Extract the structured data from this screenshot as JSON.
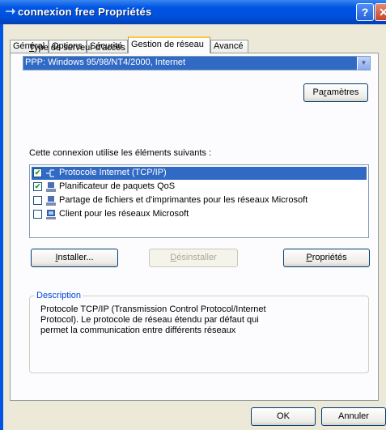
{
  "window": {
    "title": "connexion free Propriétés",
    "help_icon": "help-icon",
    "close_icon": "close-icon",
    "title_icon": "network-connection-icon"
  },
  "tabs": [
    {
      "label": "Général",
      "active": false
    },
    {
      "label": "Options",
      "active": false
    },
    {
      "label": "Sécurité",
      "active": false
    },
    {
      "label": "Gestion de réseau",
      "active": true
    },
    {
      "label": "Avancé",
      "active": false
    }
  ],
  "server_type": {
    "label_prefix": "",
    "label_underlined": "T",
    "label_rest": "ype de serveur d'accès à distance appelé :",
    "selected_value": "PPP: Windows 95/98/NT4/2000, Internet"
  },
  "buttons": {
    "settings_pre": "Pa",
    "settings_u": "r",
    "settings_post": "amètres",
    "install_pre": "",
    "install_u": "I",
    "install_post": "nstaller...",
    "uninstall_pre": "",
    "uninstall_u": "D",
    "uninstall_post": "ésinstaller",
    "properties_pre": "",
    "properties_u": "P",
    "properties_post": "ropriétés",
    "ok": "OK",
    "cancel": "Annuler"
  },
  "components": {
    "heading": "Cette connexion utilise les éléments suivants :",
    "items": [
      {
        "label": "Protocole Internet (TCP/IP)",
        "checked": true,
        "selected": true,
        "icon": "protocol-icon"
      },
      {
        "label": "Planificateur de paquets QoS",
        "checked": true,
        "selected": false,
        "icon": "service-icon"
      },
      {
        "label": "Partage de fichiers et d'imprimantes pour les réseaux Microsoft",
        "checked": false,
        "selected": false,
        "icon": "service-icon"
      },
      {
        "label": "Client pour les réseaux Microsoft",
        "checked": false,
        "selected": false,
        "icon": "client-icon"
      }
    ]
  },
  "description": {
    "title": "Description",
    "lines": [
      "Protocole TCP/IP (Transmission Control Protocol/Internet",
      "Protocol). Le protocole de réseau étendu par défaut qui",
      "permet la communication entre différents réseaux"
    ]
  },
  "colors": {
    "titlebar": "#0055e5",
    "selection": "#316ac5",
    "dialog_bg": "#ece9d8",
    "group_title": "#0046d5"
  }
}
